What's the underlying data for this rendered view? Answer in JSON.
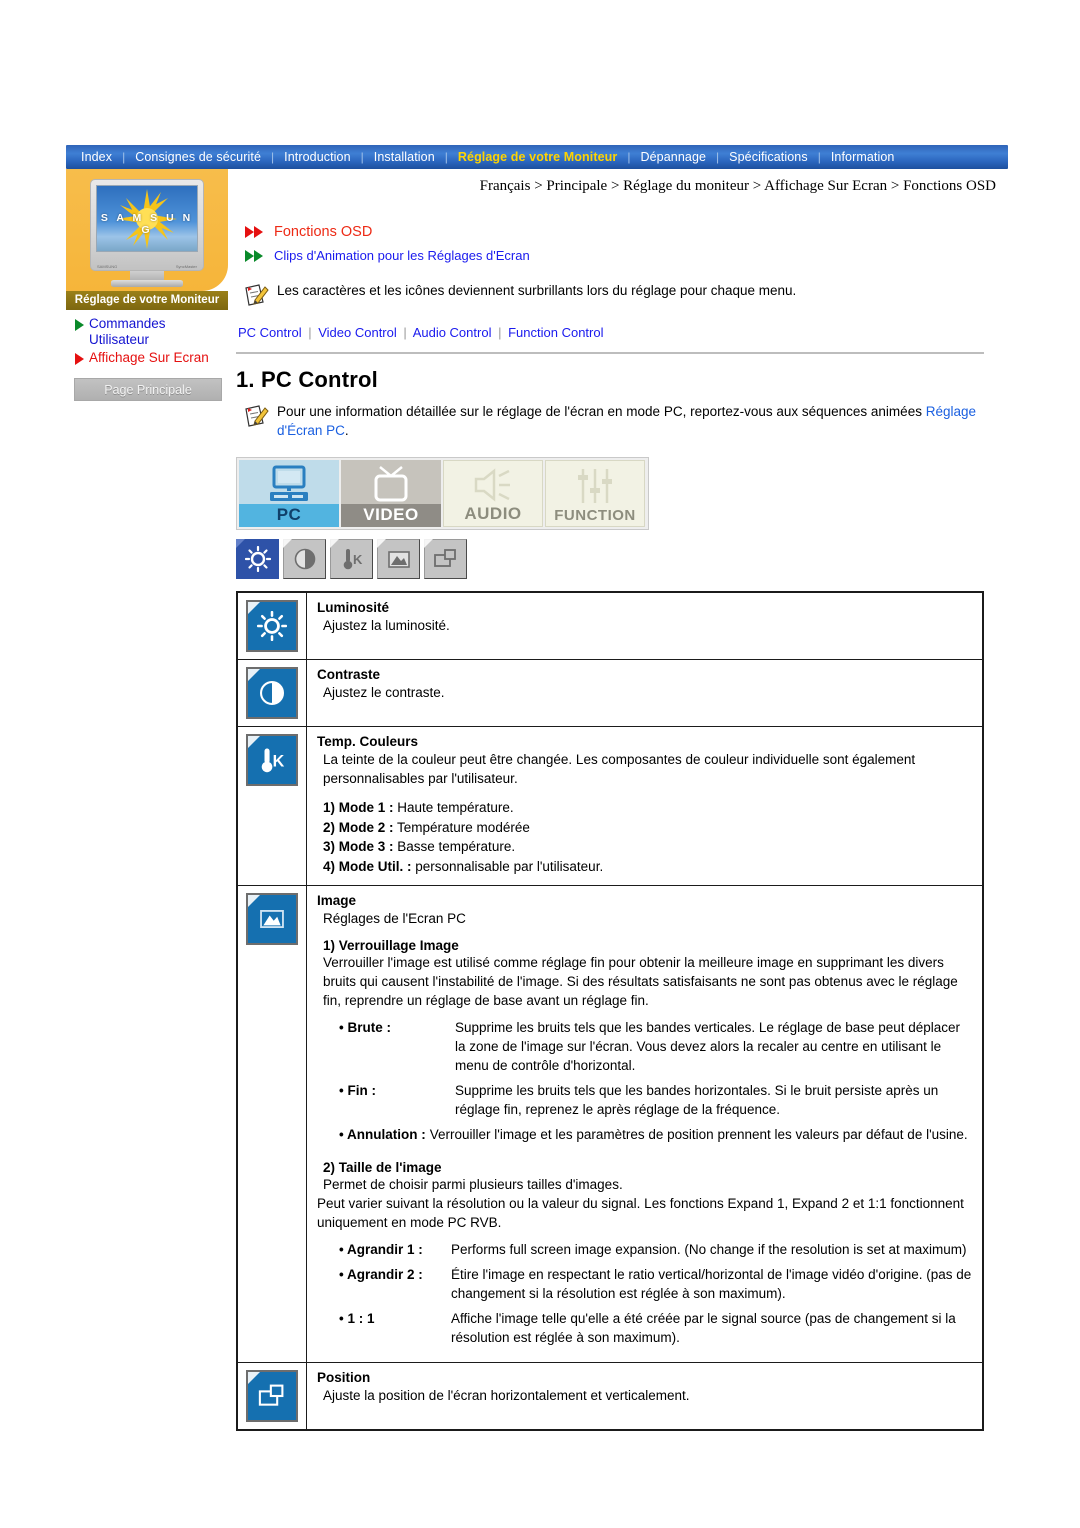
{
  "topnav": {
    "items": [
      {
        "label": "Index",
        "active": false
      },
      {
        "label": "Consignes de sécurité",
        "active": false
      },
      {
        "label": "Introduction",
        "active": false
      },
      {
        "label": "Installation",
        "active": false
      },
      {
        "label": "Réglage de votre Moniteur",
        "active": true
      },
      {
        "label": "Dépannage",
        "active": false
      },
      {
        "label": "Spécifications",
        "active": false
      },
      {
        "label": "Information",
        "active": false
      }
    ],
    "separator": "|",
    "active_color": "#ffd400",
    "bar_color": "#2f64b8"
  },
  "sidebar": {
    "monitor_brand": "S A M S U N G",
    "monitor_badge_left": "SAMSUNG",
    "monitor_badge_right": "SyncMaster",
    "title": "Réglage de votre Moniteur",
    "links": [
      {
        "label": "Commandes Utilisateur",
        "color": "#1414d0",
        "arrow_color": "#0a8a2a"
      },
      {
        "label": "Affichage Sur Ecran",
        "color": "#e51010",
        "arrow_color": "#e51010"
      }
    ],
    "home_button": "Page Principale"
  },
  "main": {
    "breadcrumb": "Français > Principale > Réglage du moniteur > Affichage Sur Ecran > Fonctions OSD",
    "heading_osd": "Fonctions OSD",
    "heading_clips": "Clips d'Animation pour les Réglages d'Ecran",
    "note": "Les caractères et les icônes deviennent surbrillants lors du réglage pour chaque menu.",
    "sublinks": [
      "PC Control",
      "Video Control",
      "Audio Control",
      "Function Control"
    ],
    "sublink_separator": "|",
    "section_title": "1. PC Control",
    "section_note_part1": "Pour une information détaillée sur le réglage de l'écran en mode PC, reportez-vous aux séquences animées ",
    "section_note_link": "Réglage d'Écran PC",
    "section_note_part2": "."
  },
  "tabs": [
    {
      "label": "PC",
      "icon": "monitor-icon",
      "state": "active"
    },
    {
      "label": "VIDEO",
      "icon": "tv-icon",
      "state": "inactive-gray"
    },
    {
      "label": "AUDIO",
      "icon": "speaker-icon",
      "state": "inactive-cream"
    },
    {
      "label": "FUNCTION",
      "icon": "sliders-icon",
      "state": "inactive-cream"
    }
  ],
  "icon_strip": [
    {
      "icon": "brightness-sun-icon",
      "active": true
    },
    {
      "icon": "contrast-halfcircle-icon",
      "active": false
    },
    {
      "icon": "color-temperature-icon",
      "active": false
    },
    {
      "icon": "image-mountain-icon",
      "active": false
    },
    {
      "icon": "position-rectangles-icon",
      "active": false
    }
  ],
  "table": {
    "rows": [
      {
        "icon": "brightness-sun-icon",
        "title": "Luminosité",
        "desc": "Ajustez la luminosité."
      },
      {
        "icon": "contrast-halfcircle-icon",
        "title": "Contraste",
        "desc": "Ajustez le contraste."
      },
      {
        "icon": "color-temperature-icon",
        "title": "Temp. Couleurs",
        "desc": "La teinte de la couleur peut être changée. Les composantes de couleur individuelle sont également personnalisables par l'utilisateur.",
        "modes": [
          {
            "label": "1) Mode 1 :",
            "text": " Haute température."
          },
          {
            "label": "2) Mode 2 :",
            "text": " Température modérée"
          },
          {
            "label": "3) Mode 3 :",
            "text": " Basse température."
          },
          {
            "label": "4) Mode Util. :",
            "text": " personnalisable par l'utilisateur."
          }
        ]
      },
      {
        "icon": "image-mountain-icon",
        "title": "Image",
        "desc": "Réglages de l'Ecran PC",
        "sub1_head": "1) Verrouillage Image",
        "sub1_body": "Verrouiller l'image est utilisé comme réglage fin pour obtenir la meilleure image en supprimant les divers bruits qui causent l'instabilité de l'image. Si des résultats satisfaisants ne sont pas obtenus avec le réglage fin, reprendre un réglage de base avant un réglage fin.",
        "sub1_bullets": [
          {
            "label": "• Brute :",
            "text": "Supprime les bruits tels que les bandes verticales. Le réglage de base peut déplacer la zone de l'image sur l'écran. Vous devez alors la recaler au centre en utilisant le menu de contrôle d'horizontal."
          },
          {
            "label": "• Fin :",
            "text": "Supprime les bruits tels que les bandes horizontales. Si le bruit persiste après un réglage fin, reprenez le après réglage de la fréquence."
          },
          {
            "label": "• Annulation :",
            "text": "Verrouiller l'image et les paramètres de position prennent les valeurs par défaut de l'usine.",
            "wide": true
          }
        ],
        "sub2_head": "2) Taille de l'image",
        "sub2_body1": "Permet de choisir parmi plusieurs tailles d'images.",
        "sub2_body2": "Peut varier suivant la résolution ou la valeur du signal. Les fonctions Expand 1, Expand 2 et 1:1 fonctionnent uniquement en mode PC RVB.",
        "sub2_bullets": [
          {
            "label": "• Agrandir 1 :",
            "text": "Performs full screen image expansion. (No change if the resolution is set at maximum)"
          },
          {
            "label": "• Agrandir 2 :",
            "text": "Étire l'image en respectant le ratio vertical/horizontal de l'image vidéo d'origine. (pas de changement si la résolution est réglée à son maximum)."
          },
          {
            "label": "• 1 : 1",
            "text": "Affiche l'image telle qu'elle a été créée par le signal source (pas de changement si la résolution est réglée à son maximum)."
          }
        ]
      },
      {
        "icon": "position-rectangles-icon",
        "title": "Position",
        "desc": "Ajuste la position de l'écran horizontalement et verticalement."
      }
    ]
  },
  "colors": {
    "nav_blue": "#2f64b8",
    "active_gold": "#ffd400",
    "sidebar_orange": "#f5b942",
    "sidebar_title_olive": "#8a7215",
    "icon_blue": "#1570b0",
    "link_blue": "#1a1aee",
    "red": "#ed2a15",
    "green": "#0a8a2a"
  }
}
